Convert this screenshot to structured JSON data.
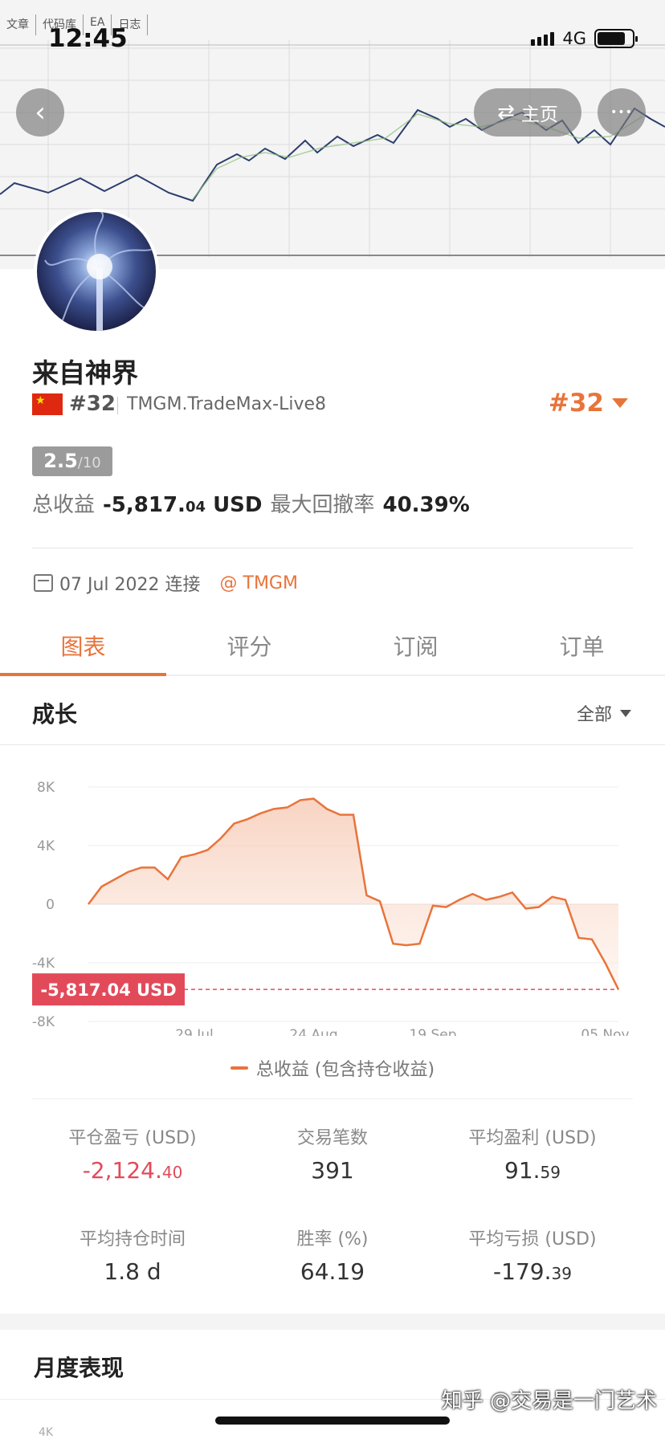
{
  "header_tabs": [
    "文章",
    "代码库",
    "EA",
    "日志"
  ],
  "status": {
    "time": "12:45",
    "network": "4G"
  },
  "nav": {
    "back_icon": "‹",
    "home_label": "主页",
    "more_icon": "•••"
  },
  "profile": {
    "name": "来自神界",
    "rank_small": "#32",
    "server": "TMGM.TradeMax-Live8",
    "rank_big": "#32",
    "score": "2.5",
    "score_max": "/10"
  },
  "summary": {
    "profit_label": "总收益",
    "profit_main": "-5,817.",
    "profit_dec": "04",
    "profit_unit": "USD",
    "drawdown_label": "最大回撤率",
    "drawdown": "40.39%"
  },
  "connect": {
    "date": "07 Jul 2022 连接",
    "broker": "@ TMGM"
  },
  "tabs": [
    "图表",
    "评分",
    "订阅",
    "订单"
  ],
  "growth": {
    "title": "成长",
    "filter": "全部"
  },
  "chart_data": {
    "type": "area",
    "yticks": [
      "8K",
      "4K",
      "0",
      "-4K",
      "-8K"
    ],
    "ylim": [
      -8000,
      8000
    ],
    "xticks": [
      "29 Jul",
      "24 Aug",
      "19 Sep",
      "05 Nov"
    ],
    "current_label": "-5,817.04 USD",
    "series": [
      {
        "name": "总收益 (包含持仓收益)",
        "x": [
          "Jul 07",
          "Jul 09",
          "Jul 12",
          "Jul 16",
          "Jul 19",
          "Jul 22",
          "Jul 24",
          "Jul 27",
          "Jul 30",
          "Aug 02",
          "Aug 05",
          "Aug 09",
          "Aug 12",
          "Aug 15",
          "Aug 18",
          "Aug 20",
          "Aug 23",
          "Aug 25",
          "Aug 27",
          "Aug 29",
          "Aug 31",
          "Sep 03",
          "Sep 05",
          "Sep 08",
          "Sep 11",
          "Sep 13",
          "Sep 16",
          "Sep 19",
          "Sep 23",
          "Sep 27",
          "Oct 01",
          "Oct 05",
          "Oct 09",
          "Oct 13",
          "Oct 17",
          "Oct 21",
          "Oct 25",
          "Oct 29",
          "Nov 02",
          "Nov 05",
          "Nov 07"
        ],
        "values": [
          0,
          1200,
          1700,
          2200,
          2500,
          2500,
          1700,
          3200,
          3400,
          3700,
          4500,
          5500,
          5800,
          6200,
          6500,
          6600,
          7100,
          7200,
          6500,
          6100,
          6100,
          600,
          200,
          -2700,
          -2800,
          -2700,
          -100,
          -200,
          300,
          700,
          300,
          500,
          800,
          -300,
          -200,
          500,
          300,
          -2300,
          -2400,
          -4000,
          -5817
        ]
      }
    ]
  },
  "legend": "总收益 (包含持仓收益)",
  "stats": [
    {
      "label": "平仓盈亏 (USD)",
      "main": "-2,124.",
      "dec": "40",
      "neg": true
    },
    {
      "label": "交易笔数",
      "main": "391",
      "dec": ""
    },
    {
      "label": "平均盈利 (USD)",
      "main": "91.",
      "dec": "59"
    },
    {
      "label": "平均持仓时间",
      "main": "1.8 d",
      "dec": ""
    },
    {
      "label": "胜率 (%)",
      "main": "64.19",
      "dec": ""
    },
    {
      "label": "平均亏损 (USD)",
      "main": "-179.",
      "dec": "39"
    }
  ],
  "monthly_title": "月度表现",
  "monthly_first_tick": "4K",
  "watermark": "知乎 @交易是一门艺术",
  "colors": {
    "accent": "#e8743b",
    "negative": "#e24a5a"
  }
}
